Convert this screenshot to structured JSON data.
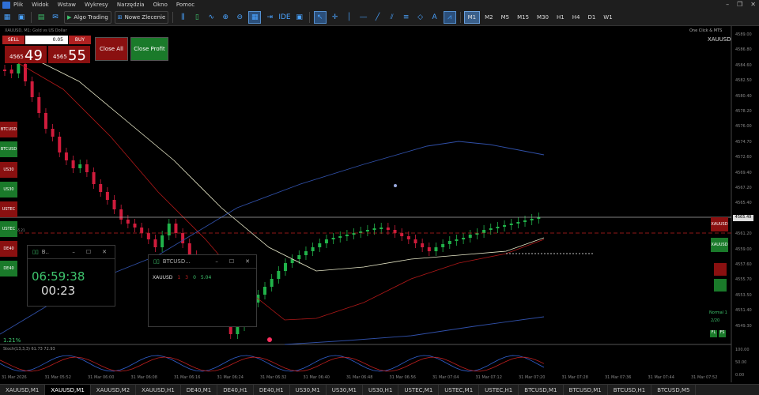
{
  "menu": {
    "items": [
      "Plik",
      "Widok",
      "Wstaw",
      "Wykresy",
      "Narzędzia",
      "Okno",
      "Pomoc"
    ]
  },
  "toolbar": {
    "algo_label": "Algo Trading",
    "new_order_label": "Nowe Zlecenie",
    "ide_label": "IDE",
    "timeframes": [
      "M1",
      "M2",
      "M5",
      "M15",
      "M30",
      "H1",
      "H4",
      "D1",
      "W1"
    ],
    "selected_timeframe": "M1"
  },
  "chart": {
    "symbol": "XAUUSD",
    "info_line": "XAUUSD, M1:  Gold vs US Dollar",
    "oneclick": "One Click & MTS",
    "right_price_current": "4565.49",
    "indicator_label": "Stoch(13,3,3) 61.73 72.93",
    "percent_label": "1.21%",
    "bid_line_label": "# 36 4565.21",
    "price_scale": [
      "4589.00",
      "4586.80",
      "4584.60",
      "4582.50",
      "4580.40",
      "4578.20",
      "4576.00",
      "4574.70",
      "4572.60",
      "4569.40",
      "4567.20",
      "4565.40",
      "4563.30",
      "4561.20",
      "4559.00",
      "4557.60",
      "4555.70",
      "4553.50",
      "4551.40",
      "4549.30"
    ],
    "stoch_scale": [
      "100.00",
      "50.00",
      "0.00"
    ],
    "time_axis": [
      "31 Mar 2026",
      "31 Mar 05:52",
      "31 Mar 06:00",
      "31 Mar 06:08",
      "31 Mar 06:16",
      "31 Mar 06:24",
      "31 Mar 06:32",
      "31 Mar 06:40",
      "31 Mar 06:48",
      "31 Mar 06:56",
      "31 Mar 07:04",
      "31 Mar 07:12",
      "31 Mar 07:20",
      "31 Mar 07:28",
      "31 Mar 07:36",
      "31 Mar 07:44",
      "31 Mar 07:52"
    ]
  },
  "trade_panel": {
    "sell_label": "SELL",
    "buy_label": "BUY",
    "lot": "0.05",
    "bid_small": "4565",
    "bid_big": "49",
    "ask_small": "4565",
    "ask_big": "55",
    "close_all": "Close All",
    "close_profit": "Close Profit"
  },
  "side_buttons": [
    "BTCUSD",
    "BTCUSD",
    "US30",
    "US30",
    "USTEC",
    "USTEC",
    "DE40",
    "DE40"
  ],
  "timer_window": {
    "title": "B..",
    "time": "06:59:38",
    "countdown": "00:23"
  },
  "mini_chart": {
    "title": "BTCUSD...",
    "symbol": "XAUUSD",
    "values": [
      "1",
      "3",
      "0",
      "5.04"
    ]
  },
  "right_panel": {
    "xau1": "XAUUSD",
    "xau2": "XAUUSD",
    "normal": "Normal 1",
    "val": "2/20",
    "b1": "FL",
    "b2": "FS"
  },
  "tabs": [
    "XAUUSD,M1",
    "XAUUSD,M1",
    "XAUUSD,M2",
    "XAUUSD,H1",
    "DE40,M1",
    "DE40,H1",
    "DE40,H1",
    "US30,M1",
    "US30,M1",
    "US30,H1",
    "USTEC,M1",
    "USTEC,M1",
    "USTEC,H1",
    "BTCUSD,M1",
    "BTCUSD,M1",
    "BTCUSD,H1",
    "BTCUSD,M5"
  ],
  "active_tab": 1
}
